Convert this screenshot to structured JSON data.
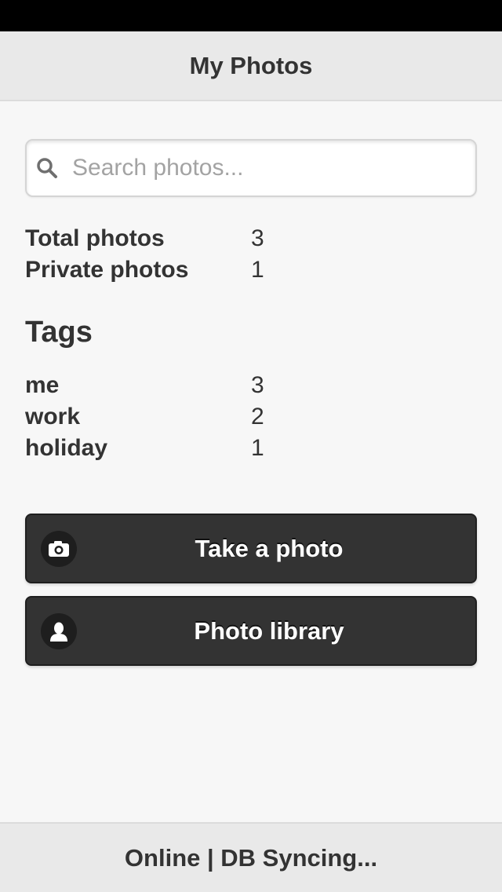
{
  "header": {
    "title": "My Photos"
  },
  "search": {
    "placeholder": "Search photos...",
    "value": "",
    "icon": "search-icon"
  },
  "stats": [
    {
      "label": "Total photos",
      "value": "3"
    },
    {
      "label": "Private photos",
      "value": "1"
    }
  ],
  "tags": {
    "heading": "Tags",
    "items": [
      {
        "label": "me",
        "count": "3"
      },
      {
        "label": "work",
        "count": "2"
      },
      {
        "label": "holiday",
        "count": "1"
      }
    ]
  },
  "buttons": {
    "take_photo": {
      "label": "Take a photo",
      "icon": "camera-icon"
    },
    "photo_library": {
      "label": "Photo library",
      "icon": "user-icon"
    }
  },
  "footer": {
    "status": "Online | DB Syncing..."
  },
  "colors": {
    "header_bg": "#e9e9e9",
    "page_bg": "#f7f7f7",
    "button_bg": "#333333",
    "text": "#333333",
    "status_bar": "#000000"
  }
}
